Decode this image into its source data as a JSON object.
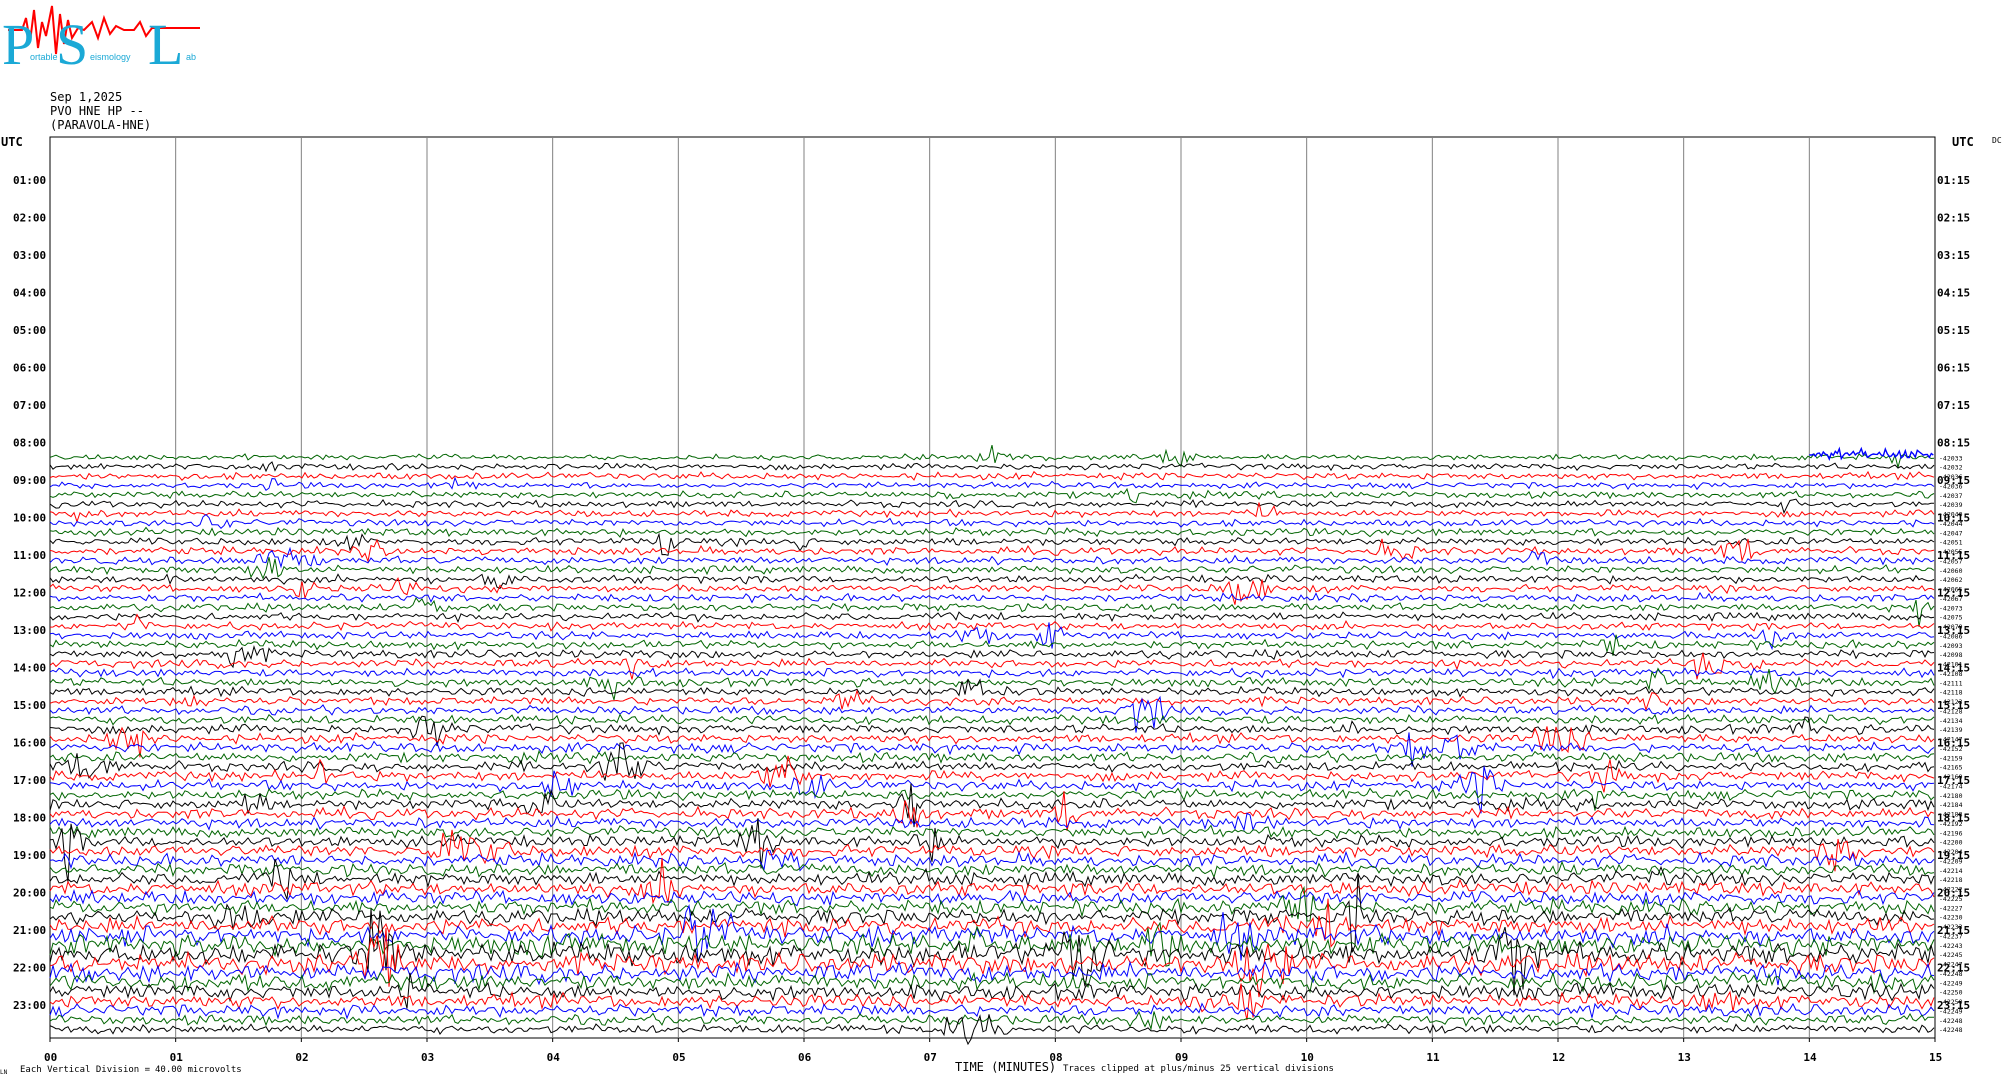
{
  "header": {
    "logo_letters": [
      "P",
      "S",
      "L"
    ],
    "logo_small_text": [
      "ortable",
      "eismology",
      "ab"
    ],
    "date": "Sep 1,2025",
    "station": "PVO HNE HP --",
    "station_name": "(PARAVOLA-HNE)"
  },
  "axes": {
    "utc_left": "UTC",
    "utc_right": "UTC",
    "dc_label": "DC",
    "hours_left": [
      "01:00",
      "02:00",
      "03:00",
      "04:00",
      "05:00",
      "06:00",
      "07:00",
      "08:00",
      "09:00",
      "10:00",
      "11:00",
      "12:00",
      "13:00",
      "14:00",
      "15:00",
      "16:00",
      "17:00",
      "18:00",
      "19:00",
      "20:00",
      "21:00",
      "22:00",
      "23:00"
    ],
    "hours_right": [
      "01:15",
      "02:15",
      "03:15",
      "04:15",
      "05:15",
      "06:15",
      "07:15",
      "08:15",
      "09:15",
      "10:15",
      "11:15",
      "12:15",
      "13:15",
      "14:15",
      "15:15",
      "16:15",
      "17:15",
      "18:15",
      "19:15",
      "20:15",
      "21:15",
      "22:15",
      "23:15"
    ],
    "minute_ticks": [
      "00",
      "01",
      "02",
      "03",
      "04",
      "05",
      "06",
      "07",
      "08",
      "09",
      "10",
      "11",
      "12",
      "13",
      "14",
      "15"
    ],
    "xlabel": "TIME (MINUTES)"
  },
  "footer": {
    "corner_mark": "LN",
    "division_text": "Each Vertical Division =",
    "division_value": "40.00 microvolts",
    "clip_note": "Traces clipped at plus/minus 25 vertical divisions"
  },
  "colors": {
    "black": "#000000",
    "red": "#ff0000",
    "blue": "#0000ff",
    "green": "#006400",
    "logo_cyan": "#1ba9d6",
    "logo_red": "#ff0000",
    "grid": "#808080"
  },
  "chart_data": {
    "type": "helicorder",
    "minutes_per_line": 15,
    "first_trace_start": "08:30",
    "color_cycle": [
      "green",
      "black",
      "red",
      "blue"
    ],
    "dc_offsets": [
      42033,
      42032,
      42036,
      42036,
      42037,
      42039,
      42040,
      42044,
      42047,
      42051,
      42055,
      42057,
      42060,
      42062,
      42065,
      42067,
      42073,
      42075,
      42079,
      42086,
      42093,
      42098,
      42101,
      42108,
      42111,
      42118,
      42123,
      42128,
      42134,
      42139,
      42147,
      42152,
      42159,
      42165,
      42169,
      42174,
      42180,
      42184,
      42188,
      42192,
      42196,
      42200,
      42204,
      42209,
      42214,
      42218,
      42222,
      42225,
      42227,
      42230,
      42233,
      42237,
      42243,
      42245,
      42247,
      42248,
      42249,
      42250,
      42250,
      42249,
      42248,
      42248,
      42247,
      42246,
      42246,
      42245,
      42244,
      42243,
      42243,
      42242,
      42241,
      42239,
      42236,
      42234,
      42232,
      42229,
      42226,
      42225,
      42224,
      42221,
      42217,
      42215,
      42213,
      42211,
      42209,
      42206,
      42204,
      42203,
      42202,
      42200,
      42199,
      42198,
      42196,
      42194,
      42193,
      42191,
      42189,
      42187,
      42185,
      42183,
      42181
    ],
    "noise_level": [
      0.7,
      0.8,
      0.9,
      0.8,
      0.9,
      0.9,
      0.9,
      0.9,
      1.0,
      1.0,
      1.0,
      1.0,
      1.0,
      1.0,
      1.0,
      1.0,
      1.0,
      1.0,
      1.0,
      1.0,
      1.1,
      1.1,
      1.1,
      1.1,
      1.1,
      1.1,
      1.1,
      1.1,
      1.2,
      1.2,
      1.2,
      1.3,
      1.3,
      1.3,
      1.3,
      1.3,
      1.3,
      1.4,
      1.4,
      1.4,
      1.4,
      1.5,
      1.6,
      1.6,
      1.6,
      1.7,
      1.8,
      1.8,
      1.9,
      2.0,
      2.2,
      2.4,
      2.6,
      2.8,
      2.6,
      2.4,
      2.2,
      2.0,
      1.8,
      1.6,
      1.3,
      1.2,
      1.0,
      0.9,
      0.8,
      0.8,
      0.8,
      0.8,
      0.8,
      0.8,
      0.7,
      0.7,
      0.7,
      0.7,
      0.7,
      0.6,
      0.6,
      0.6,
      0.6,
      0.6,
      0.6,
      0.6,
      0.6,
      0.6,
      0.6,
      0.6,
      0.6,
      0.6,
      0.6,
      0.5,
      0.5,
      0.5,
      0.5,
      0.5,
      0.5,
      0.5,
      0.5,
      0.5,
      0.5,
      0.5,
      0.5
    ]
  }
}
